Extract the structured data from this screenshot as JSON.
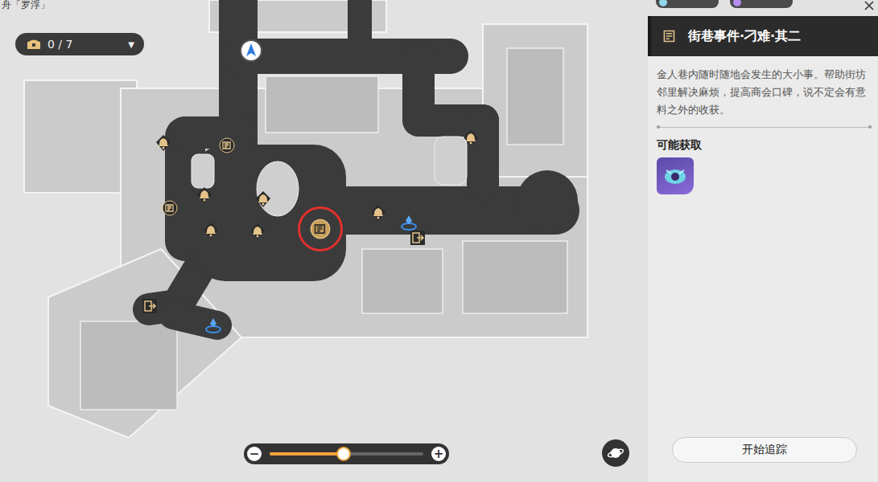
{
  "map": {
    "region": "舟「罗浮」",
    "chest_counter": "0 / 7",
    "dropdown": "▼"
  },
  "pins": [
    {
      "kind": "shop",
      "selected": false
    },
    {
      "kind": "shop",
      "selected": false
    },
    {
      "kind": "shop",
      "selected": false
    },
    {
      "kind": "shop",
      "selected": false
    },
    {
      "kind": "shop",
      "selected": false
    },
    {
      "kind": "shop",
      "selected": false
    },
    {
      "kind": "shop",
      "selected": false
    },
    {
      "kind": "event",
      "selected": false
    },
    {
      "kind": "event",
      "selected": false
    },
    {
      "kind": "event",
      "selected": true
    },
    {
      "kind": "teleport",
      "selected": false
    },
    {
      "kind": "teleport",
      "selected": false
    },
    {
      "kind": "exit",
      "selected": false
    },
    {
      "kind": "exit",
      "selected": false
    },
    {
      "kind": "player",
      "selected": false
    }
  ],
  "zoom": {
    "minus": "−",
    "plus": "+",
    "level": 0.48
  },
  "panel": {
    "title": "街巷事件·刁难·其二",
    "description": "金人巷内随时随地会发生的大小事。帮助街坊邻里解决麻烦，提高商会口碑，说不定会有意料之外的收获。",
    "rewards_label": "可能获取",
    "rewards": [
      {
        "kind": "item"
      }
    ],
    "button": "开始追踪"
  }
}
